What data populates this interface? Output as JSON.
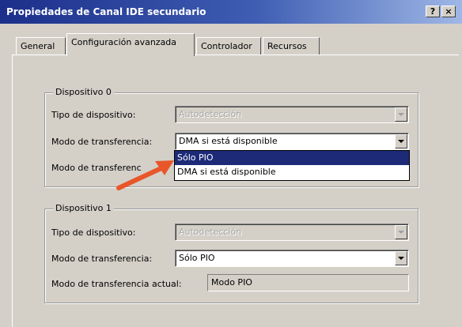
{
  "window": {
    "title": "Propiedades de Canal IDE secundario",
    "help_button": "?",
    "close_button": "×"
  },
  "tabs": [
    {
      "label": "General",
      "active": false
    },
    {
      "label": "Configuración avanzada",
      "active": true
    },
    {
      "label": "Controlador",
      "active": false
    },
    {
      "label": "Recursos",
      "active": false
    }
  ],
  "device0": {
    "legend": "Dispositivo 0",
    "type_label": "Tipo de dispositivo:",
    "type_value": "Autodetección",
    "type_enabled": false,
    "mode_label": "Modo de transferencia:",
    "mode_value": "DMA si está disponible",
    "current_label": "Modo de transferenc",
    "dropdown_options": [
      {
        "label": "Sólo PIO",
        "selected": true
      },
      {
        "label": "DMA si está disponible",
        "selected": false
      }
    ]
  },
  "device1": {
    "legend": "Dispositivo 1",
    "type_label": "Tipo de dispositivo:",
    "type_value": "Autodetección",
    "type_enabled": false,
    "mode_label": "Modo de transferencia:",
    "mode_value": "Sólo PIO",
    "current_label": "Modo de transferencia actual:",
    "current_value": "Modo PIO"
  },
  "annotation": {
    "arrow_color": "#e8562a"
  },
  "colors": {
    "title_bar_start": "#1c2f8a",
    "face": "#d4d0c8",
    "selection": "#1c2a78"
  }
}
